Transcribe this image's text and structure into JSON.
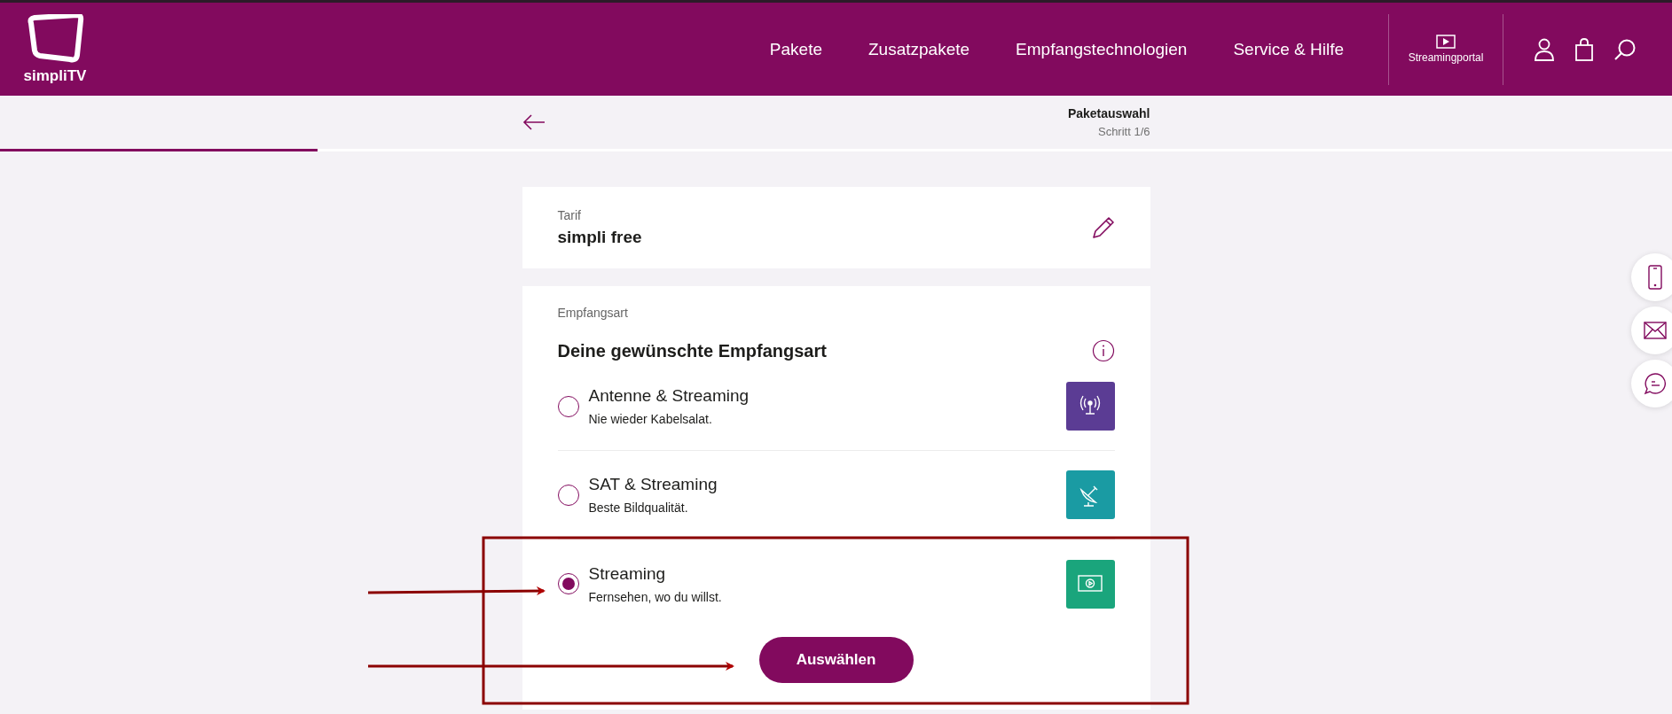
{
  "header": {
    "logo_text": "simpliTV",
    "nav": [
      {
        "label": "Pakete"
      },
      {
        "label": "Zusatzpakete"
      },
      {
        "label": "Empfangstechnologien"
      },
      {
        "label": "Service & Hilfe"
      }
    ],
    "streaming_portal": "Streamingportal"
  },
  "step": {
    "title": "Paketauswahl",
    "subtitle": "Schritt 1/6",
    "level": 0.19
  },
  "tarif": {
    "label": "Tarif",
    "value": "simpli free"
  },
  "reception": {
    "label": "Empfangsart",
    "heading": "Deine gewünschte Empfangsart",
    "options": [
      {
        "kind": "antenna",
        "title": "Antenne & Streaming",
        "subtitle": "Nie wieder Kabelsalat.",
        "selected": false,
        "color": "#5b3c94"
      },
      {
        "kind": "satellite",
        "title": "SAT & Streaming",
        "subtitle": "Beste Bildqualität.",
        "selected": false,
        "color": "#1a9ba3"
      },
      {
        "kind": "streaming",
        "title": "Streaming",
        "subtitle": "Fernsehen, wo du willst.",
        "selected": true,
        "color": "#1aa57c"
      }
    ],
    "button": "Auswählen"
  }
}
